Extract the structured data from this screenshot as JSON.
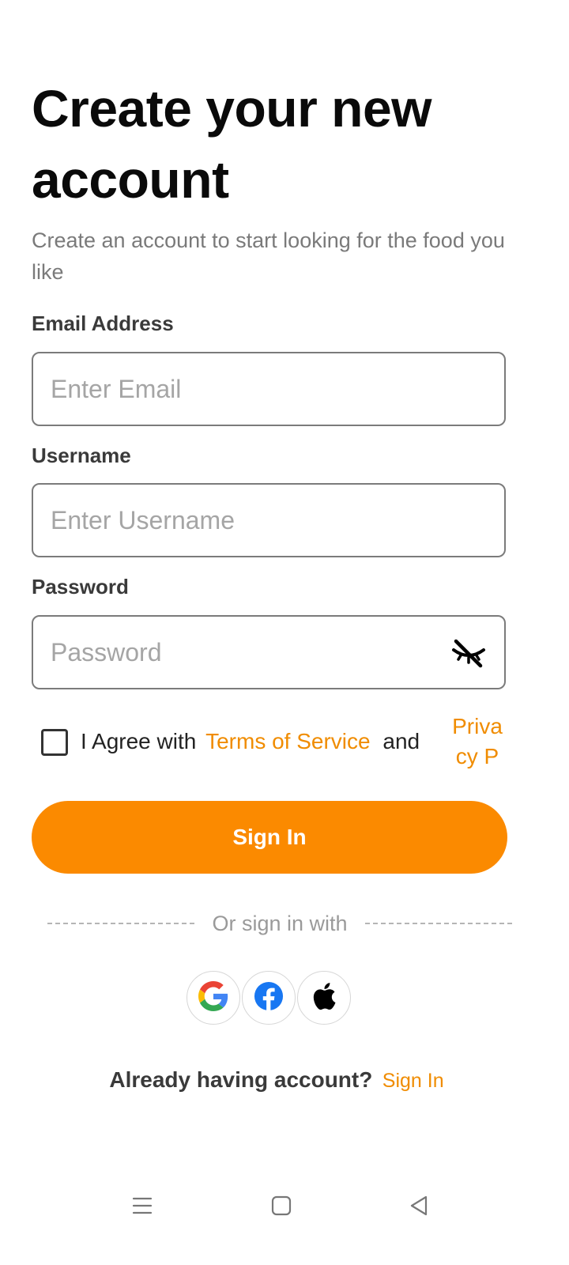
{
  "header": {
    "title": "Create your new account",
    "subtitle": "Create an account to start looking for the food you like"
  },
  "form": {
    "email": {
      "label": "Email Address",
      "placeholder": "Enter Email",
      "value": ""
    },
    "username": {
      "label": "Username",
      "placeholder": "Enter Username",
      "value": ""
    },
    "password": {
      "label": "Password",
      "placeholder": "Password",
      "value": "",
      "visibility_icon": "eye-off-icon"
    },
    "agree": {
      "checked": false,
      "prefix": "I Agree with",
      "terms_link": "Terms of Service",
      "and_text": "and",
      "privacy_link": "Privacy Po.."
    },
    "submit_label": "Sign In"
  },
  "alt_signin": {
    "divider_text": "Or sign in with",
    "providers": [
      "google-icon",
      "facebook-icon",
      "apple-icon"
    ]
  },
  "footer": {
    "prompt": "Already having account?",
    "link": "Sign In"
  },
  "nav": {
    "icons": [
      "menu-icon",
      "home-square-icon",
      "back-triangle-icon"
    ]
  },
  "colors": {
    "accent": "#fb8a00",
    "link": "#f08c00",
    "text_dark": "#0a0a0a",
    "text_muted": "#7a7a7a",
    "border": "#7b7b7b"
  }
}
